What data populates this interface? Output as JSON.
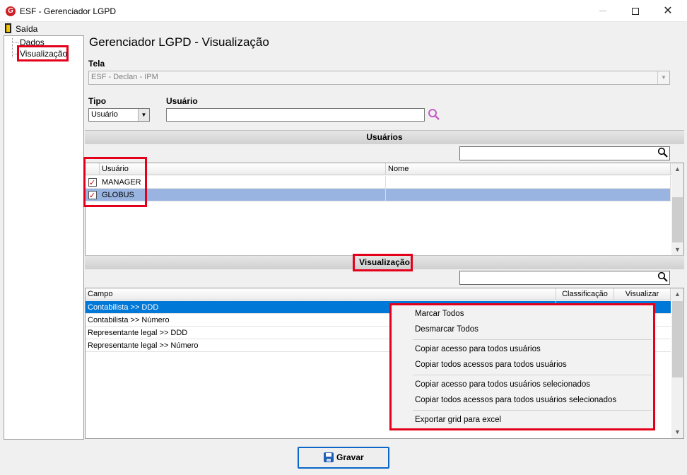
{
  "window": {
    "title": "ESF - Gerenciador LGPD",
    "logo_letter": "G"
  },
  "menu": {
    "exit_label": "Saída"
  },
  "tree": {
    "items": [
      {
        "label": "Dados"
      },
      {
        "label": "Visualização"
      }
    ]
  },
  "page": {
    "title": "Gerenciador LGPD - Visualização"
  },
  "form": {
    "tela_label": "Tela",
    "tela_value": "ESF - Declan - IPM",
    "tipo_label": "Tipo",
    "tipo_value": "Usuário",
    "usuario_label": "Usuário",
    "usuario_value": ""
  },
  "usuarios": {
    "section_title": "Usuários",
    "search_value": "",
    "columns": [
      "Usuário",
      "Nome"
    ],
    "rows": [
      {
        "checked": true,
        "usuario": "MANAGER",
        "nome": ""
      },
      {
        "checked": true,
        "usuario": "GLOBUS",
        "nome": ""
      }
    ]
  },
  "visualizacao": {
    "section_title": "Visualização",
    "search_value": "",
    "columns": [
      "Campo",
      "Classificação",
      "Visualizar"
    ],
    "rows": [
      {
        "campo": "Contabilista >> DDD"
      },
      {
        "campo": "Contabilista >> Número"
      },
      {
        "campo": "Representante legal >> DDD"
      },
      {
        "campo": "Representante legal >> Número"
      }
    ]
  },
  "context_menu": {
    "items": [
      "Marcar Todos",
      "Desmarcar Todos",
      "Copiar acesso para todos usuários",
      "Copiar todos acessos para todos usuários",
      "Copiar acesso para todos usuários selecionados",
      "Copiar todos acessos para todos usuários selecionados",
      "Exportar grid para excel"
    ]
  },
  "actions": {
    "save_label": "Gravar"
  },
  "colors": {
    "highlight": "#e4001b",
    "selected_row": "#99b4e1",
    "selected_row_active": "#0078d7"
  }
}
